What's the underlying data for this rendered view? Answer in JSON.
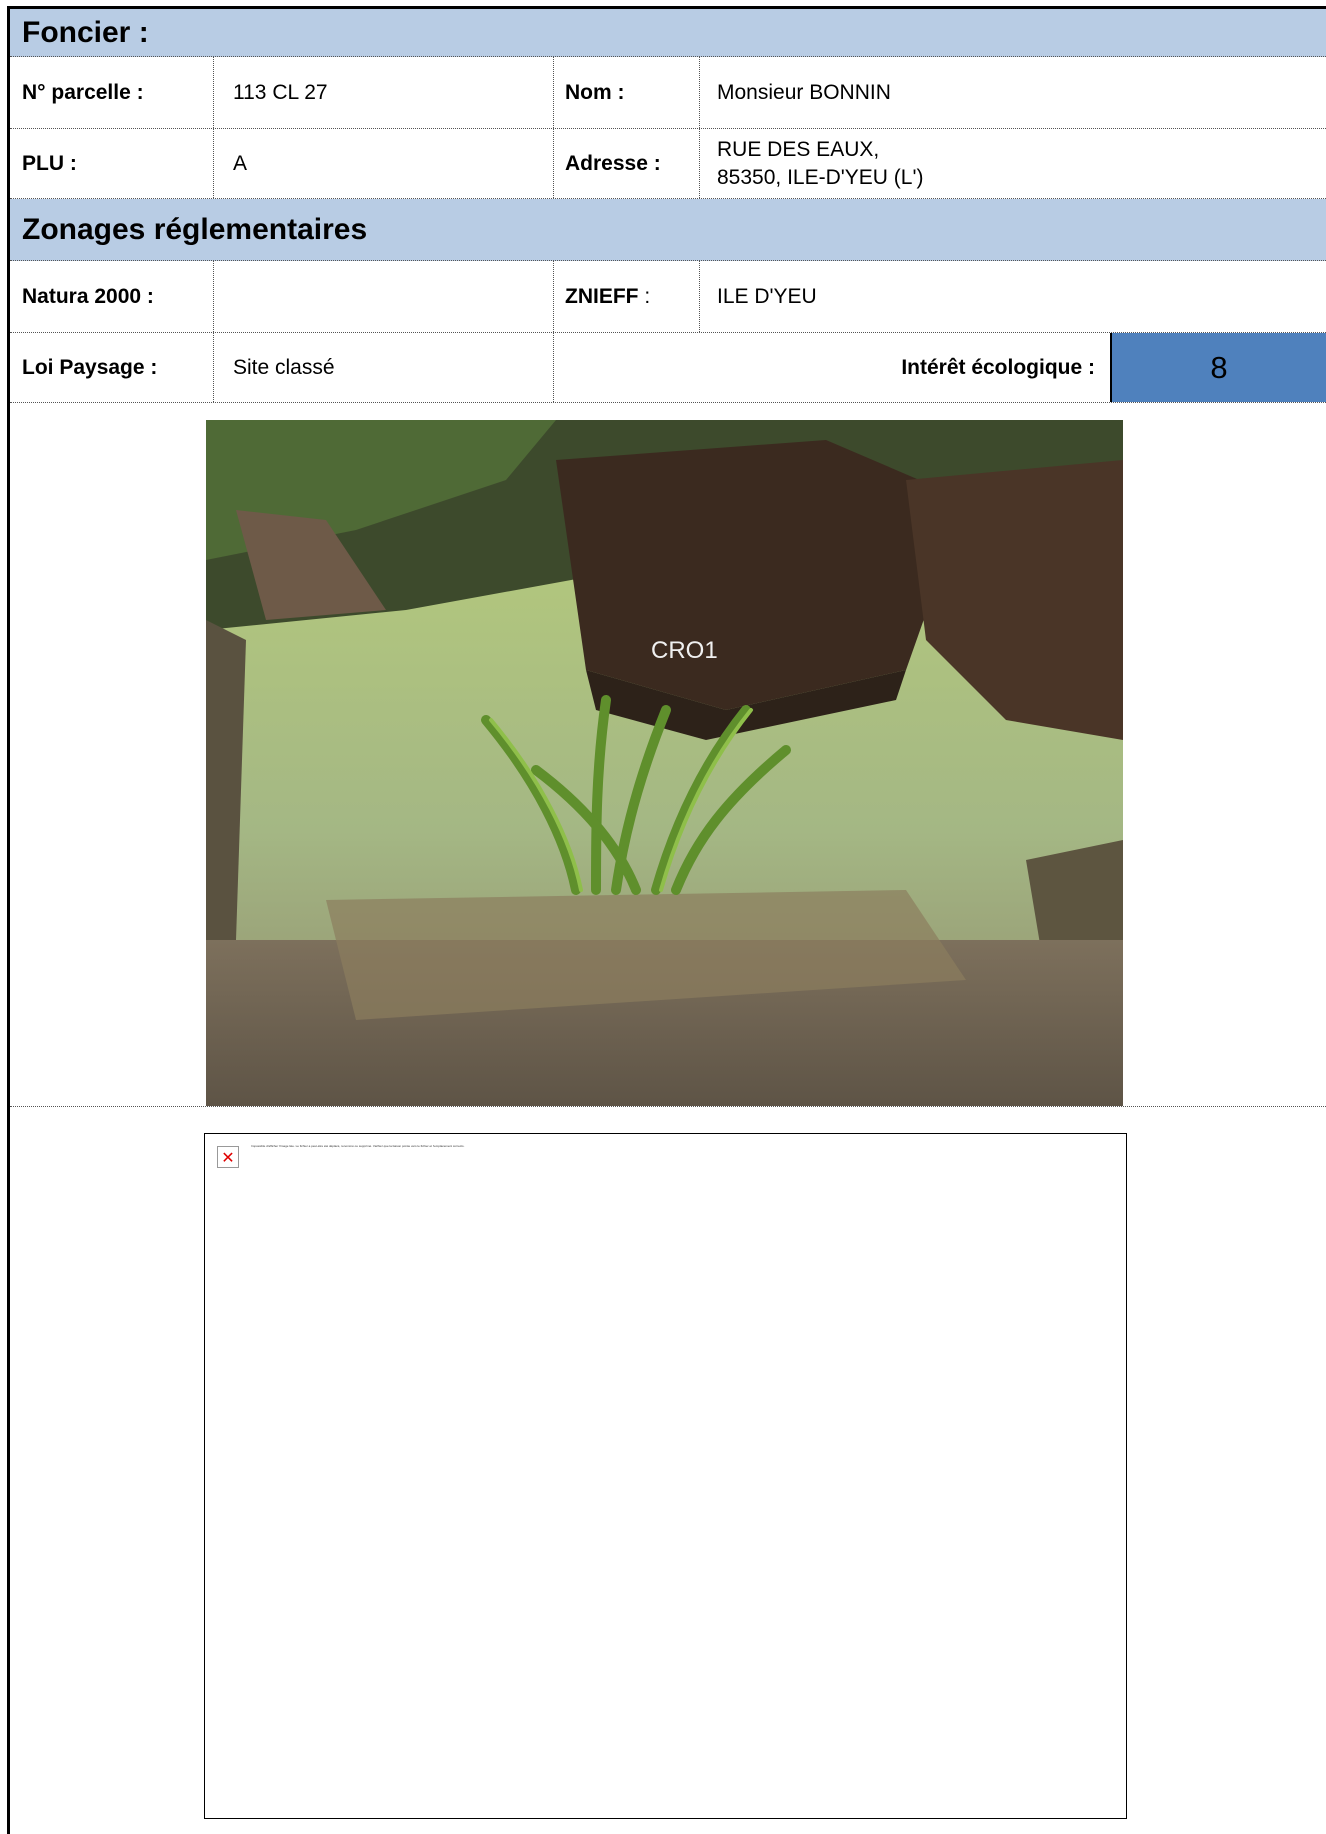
{
  "foncier": {
    "title": "Foncier :",
    "parcelle_label": "N° parcelle :",
    "parcelle_value": "113 CL 27",
    "nom_label": "Nom :",
    "nom_value": "Monsieur BONNIN",
    "plu_label": "PLU :",
    "plu_value": "A",
    "adresse_label": "Adresse :",
    "adresse_line1": "RUE DES EAUX,",
    "adresse_line2": "85350, ILE-D'YEU (L')"
  },
  "zonages": {
    "title": "Zonages réglementaires",
    "natura_label": "Natura 2000 :",
    "natura_value": "",
    "znieff_label": "ZNIEFF",
    "znieff_colon": " :",
    "znieff_value": "ILE D'YEU",
    "loi_label": "Loi Paysage :",
    "loi_value": "Site classé",
    "interet_label": "Intérêt écologique :",
    "interet_value": "8"
  },
  "photo": {
    "caption": "CRO1"
  },
  "broken_image": {
    "icon": "broken-image-icon",
    "message": "Impossible d'afficher l'image liée. Le fichier a peut-être été déplacé, renommé ou supprimé. Vérifiez que la liaison pointe vers le fichier et l'emplacement corrects."
  },
  "colors": {
    "section_header_bg": "#b8cce4",
    "score_bg": "#4f81bd"
  }
}
